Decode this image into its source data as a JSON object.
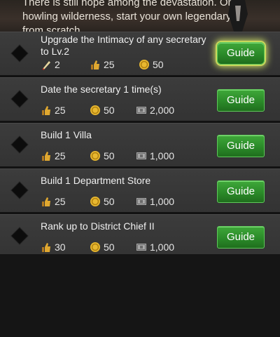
{
  "header": {
    "text_line1": "There is still hope among the devastation. On",
    "text_line2": "howling wilderness, start your own legendary",
    "text_line3": "from scratch."
  },
  "tasks": [
    {
      "title": "Upgrade the Intimacy of any secretary to Lv.2",
      "rewards": [
        {
          "icon": "feather-icon",
          "value": "2"
        },
        {
          "icon": "thumbs-up-icon",
          "value": "25"
        },
        {
          "icon": "coin-icon",
          "value": "50"
        }
      ],
      "button": "Guide",
      "highlighted": true
    },
    {
      "title": "Date the secretary 1 time(s)",
      "rewards": [
        {
          "icon": "thumbs-up-icon",
          "value": "25"
        },
        {
          "icon": "coin-icon",
          "value": "50"
        },
        {
          "icon": "cash-icon",
          "value": "2,000"
        }
      ],
      "button": "Guide",
      "highlighted": false
    },
    {
      "title": "Build 1 Villa",
      "rewards": [
        {
          "icon": "thumbs-up-icon",
          "value": "25"
        },
        {
          "icon": "coin-icon",
          "value": "50"
        },
        {
          "icon": "cash-icon",
          "value": "1,000"
        }
      ],
      "button": "Guide",
      "highlighted": false
    },
    {
      "title": "Build 1 Department Store",
      "rewards": [
        {
          "icon": "thumbs-up-icon",
          "value": "25"
        },
        {
          "icon": "coin-icon",
          "value": "50"
        },
        {
          "icon": "cash-icon",
          "value": "1,000"
        }
      ],
      "button": "Guide",
      "highlighted": false
    },
    {
      "title": "Rank up to District Chief II",
      "rewards": [
        {
          "icon": "thumbs-up-icon",
          "value": "30"
        },
        {
          "icon": "coin-icon",
          "value": "50"
        },
        {
          "icon": "cash-icon",
          "value": "1,000"
        }
      ],
      "button": "Guide",
      "highlighted": false
    }
  ],
  "colors": {
    "button_green": "#2b8a29",
    "coin_gold": "#e8b830",
    "thumb_gold": "#d9a030"
  }
}
